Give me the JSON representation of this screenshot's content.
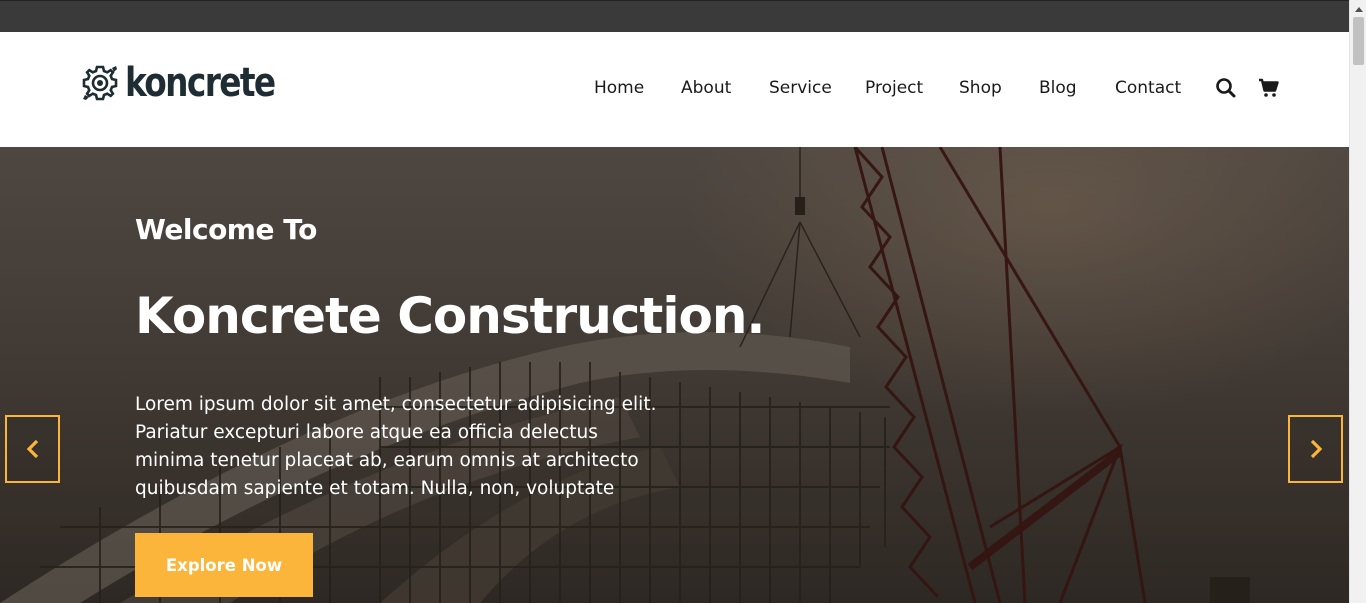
{
  "header": {
    "logo_text": "koncrete",
    "nav": [
      {
        "label": "Home"
      },
      {
        "label": "About"
      },
      {
        "label": "Service"
      },
      {
        "label": "Project"
      },
      {
        "label": "Shop"
      },
      {
        "label": "Blog"
      },
      {
        "label": "Contact"
      }
    ],
    "icons": [
      "search-icon",
      "cart-icon"
    ]
  },
  "hero": {
    "welcome": "Welcome To",
    "headline": "Koncrete Construction.",
    "description": "Lorem ipsum dolor sit amet, consectetur adipisicing elit. Pariatur excepturi labore atque ea officia delectus minima tenetur placeat ab, earum omnis at architecto quibusdam sapiente et totam. Nulla, non, voluptate",
    "cta_label": "Explore Now",
    "prev_icon": "chevron-left-icon",
    "next_icon": "chevron-right-icon"
  },
  "colors": {
    "accent": "#fbb53b",
    "logo": "#1e2d33",
    "topbar": "#3a3a3a",
    "hero_overlay": "#4e4640"
  }
}
